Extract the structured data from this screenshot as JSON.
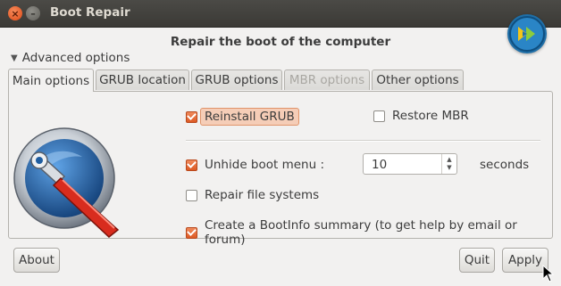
{
  "window": {
    "title": "Boot Repair"
  },
  "heading": "Repair the boot of the computer",
  "expander": {
    "label": "Advanced options",
    "expanded": true
  },
  "tabs": [
    {
      "label": "Main options",
      "active": true,
      "enabled": true
    },
    {
      "label": "GRUB location",
      "active": false,
      "enabled": true
    },
    {
      "label": "GRUB options",
      "active": false,
      "enabled": true
    },
    {
      "label": "MBR options",
      "active": false,
      "enabled": false
    },
    {
      "label": "Other options",
      "active": false,
      "enabled": true
    }
  ],
  "main_options": {
    "reinstall_grub": {
      "label": "Reinstall GRUB",
      "checked": true
    },
    "restore_mbr": {
      "label": "Restore MBR",
      "checked": false
    },
    "unhide_boot_menu": {
      "label": "Unhide boot menu :",
      "checked": true,
      "value": "10",
      "units": "seconds"
    },
    "repair_file_systems": {
      "label": "Repair file systems",
      "checked": false
    },
    "bootinfo_summary": {
      "label": "Create a BootInfo summary (to get help by email or forum)",
      "checked": true
    }
  },
  "buttons": {
    "about": "About",
    "quit": "Quit",
    "apply": "Apply"
  },
  "icons": {
    "window_close": "close-icon",
    "window_minimize": "minimize-icon",
    "app_logo": "boot-repair-logo",
    "tool": "wrench-icon",
    "spin_arrows": "spin-arrows-icon",
    "cursor": "mouse-pointer"
  },
  "colors": {
    "accent": "#dd4814",
    "titlebar": "#3c3b37",
    "window_bg": "#f2f1f0",
    "logo_bg": "#1f6fa8"
  }
}
